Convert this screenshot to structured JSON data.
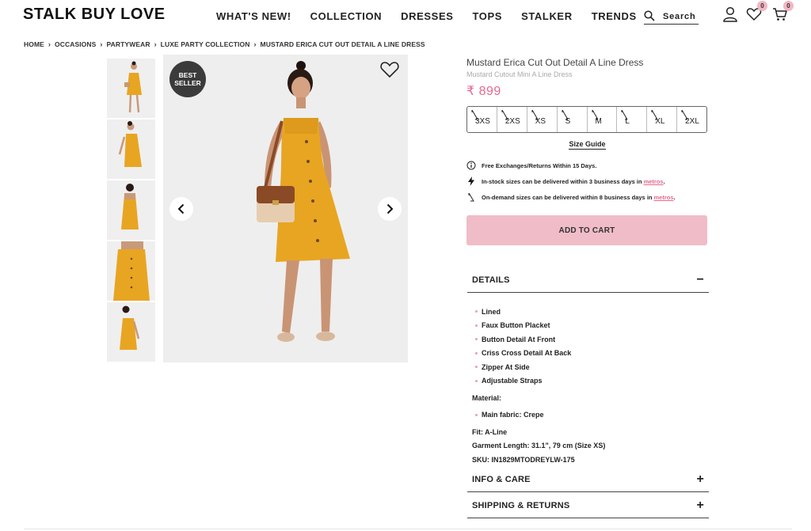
{
  "header": {
    "logo": "STALK BUY LOVE",
    "nav": [
      "WHAT'S NEW!",
      "COLLECTION",
      "DRESSES",
      "TOPS",
      "STALKER",
      "TRENDS"
    ],
    "search_label": "Search",
    "wishlist_count": "0",
    "cart_count": "0"
  },
  "breadcrumb": [
    "HOME",
    "OCCASIONS",
    "PARTYWEAR",
    "LUXE PARTY COLLECTION",
    "MUSTARD ERICA CUT OUT DETAIL A LINE DRESS"
  ],
  "gallery": {
    "badge_line1": "BEST",
    "badge_line2": "SELLER"
  },
  "product": {
    "title": "Mustard Erica Cut Out Detail A Line Dress",
    "subtitle": "Mustard Cutout Mini A Line Dress",
    "price": "₹ 899",
    "sizes": [
      "3XS",
      "2XS",
      "XS",
      "S",
      "M",
      "L",
      "XL",
      "2XL"
    ],
    "size_guide": "Size Guide",
    "notes": [
      {
        "text": "Free Exchanges/Returns Within 15 Days.",
        "link": "",
        "suffix": ""
      },
      {
        "text": "In-stock sizes can be delivered within 3 business days in",
        "link": "metros",
        "suffix": "."
      },
      {
        "text": "On-demand sizes can be delivered within 8 business days in",
        "link": "metros",
        "suffix": "."
      }
    ],
    "add_to_cart": "ADD TO CART"
  },
  "accordion": {
    "details_label": "DETAILS",
    "details_sign": "−",
    "info_label": "INFO & CARE",
    "info_sign": "+",
    "shipping_label": "SHIPPING & RETURNS",
    "shipping_sign": "+"
  },
  "details": {
    "bullets": [
      "Lined",
      "Faux Button Placket",
      "Button Detail At Front",
      "Criss Cross Detail At Back",
      "Zipper At Side",
      "Adjustable Straps"
    ],
    "material_label": "Material:",
    "material_bullets": [
      "Main fabric: Crepe"
    ],
    "fit": "Fit: A-Line",
    "length": "Garment Length: 31.1\", 79 cm (Size XS)",
    "sku": "SKU: IN1829MTODREYLW-175"
  },
  "colors": {
    "accent": "#e6698d",
    "cart_button": "#f0bcc8",
    "dress": "#e8a522"
  }
}
